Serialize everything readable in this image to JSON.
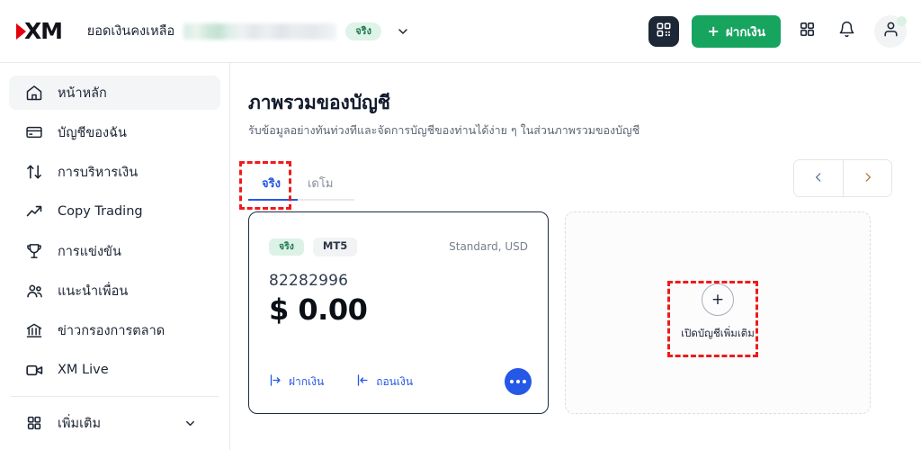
{
  "brand": {
    "logo_text": "XM",
    "logo_mark": "red-triangle"
  },
  "header": {
    "balance_label": "ยอดเงินคงเหลือ",
    "balance_value_hidden": "",
    "account_mode_pill": "จริง",
    "chevron_icon": "chevron-down-icon",
    "qr_icon": "qr-scan-icon",
    "deposit_button": {
      "plus": "+",
      "label": "ฝากเงิน"
    },
    "apps_icon": "grid-apps-icon",
    "bell_icon": "notification-bell-icon",
    "avatar_icon": "user-avatar-icon"
  },
  "sidebar": {
    "items": [
      {
        "label": "หน้าหลัก",
        "icon": "home-icon",
        "active": true
      },
      {
        "label": "บัญชีของฉัน",
        "icon": "card-icon",
        "active": false
      },
      {
        "label": "การบริหารเงิน",
        "icon": "transfer-arrows-icon",
        "active": false
      },
      {
        "label": "Copy Trading",
        "icon": "trend-up-icon",
        "active": false
      },
      {
        "label": "การแข่งขัน",
        "icon": "trophy-icon",
        "active": false
      },
      {
        "label": "แนะนำเพื่อน",
        "icon": "people-group-icon",
        "active": false
      },
      {
        "label": "ข่าวกรองการตลาด",
        "icon": "bank-icon",
        "active": false
      },
      {
        "label": "XM Live",
        "icon": "video-camera-icon",
        "active": false
      }
    ],
    "more": {
      "label": "เพิ่มเติม",
      "icon": "grid-apps-icon",
      "chevron": "chevron-down-icon"
    }
  },
  "main": {
    "title": "ภาพรวมของบัญชี",
    "subtitle": "รับข้อมูลอย่างทันท่วงทีและจัดการบัญชีของท่านได้ง่าย ๆ ในส่วนภาพรวมของบัญชี",
    "tabs": [
      {
        "label": "จริง",
        "active": true
      },
      {
        "label": "เดโม",
        "active": false
      }
    ],
    "pager": {
      "prev_icon": "chevron-left-icon",
      "next_icon": "chevron-right-icon",
      "prev": "‹",
      "next": "›"
    },
    "account_card": {
      "badge_real": "จริง",
      "badge_platform": "MT5",
      "account_type": "Standard, USD",
      "account_number": "82282996",
      "balance": "$ 0.00",
      "deposit_link": {
        "label": "ฝากเงิน",
        "icon": "arrow-into-right-icon"
      },
      "withdraw_link": {
        "label": "ถอนเงิน",
        "icon": "arrow-out-left-icon"
      },
      "more_button_icon": "ellipsis-icon"
    },
    "add_account_card": {
      "plus": "+",
      "label": "เปิดบัญชีเพิ่มเติม",
      "plus_icon": "plus-circle-icon"
    }
  },
  "colors": {
    "brand_red": "#e3000f",
    "accent_blue": "#2558e6",
    "deposit_green": "#17a45f",
    "badge_green_bg": "#ddf2e7",
    "badge_green_text": "#1d7b4e",
    "annotation_red": "#ee1b1b",
    "card_border": "#1d2a3d"
  },
  "annotations": [
    {
      "name": "tab-real-highlight",
      "target": "tab-real"
    },
    {
      "name": "add-account-highlight",
      "target": "add-account-button"
    }
  ]
}
